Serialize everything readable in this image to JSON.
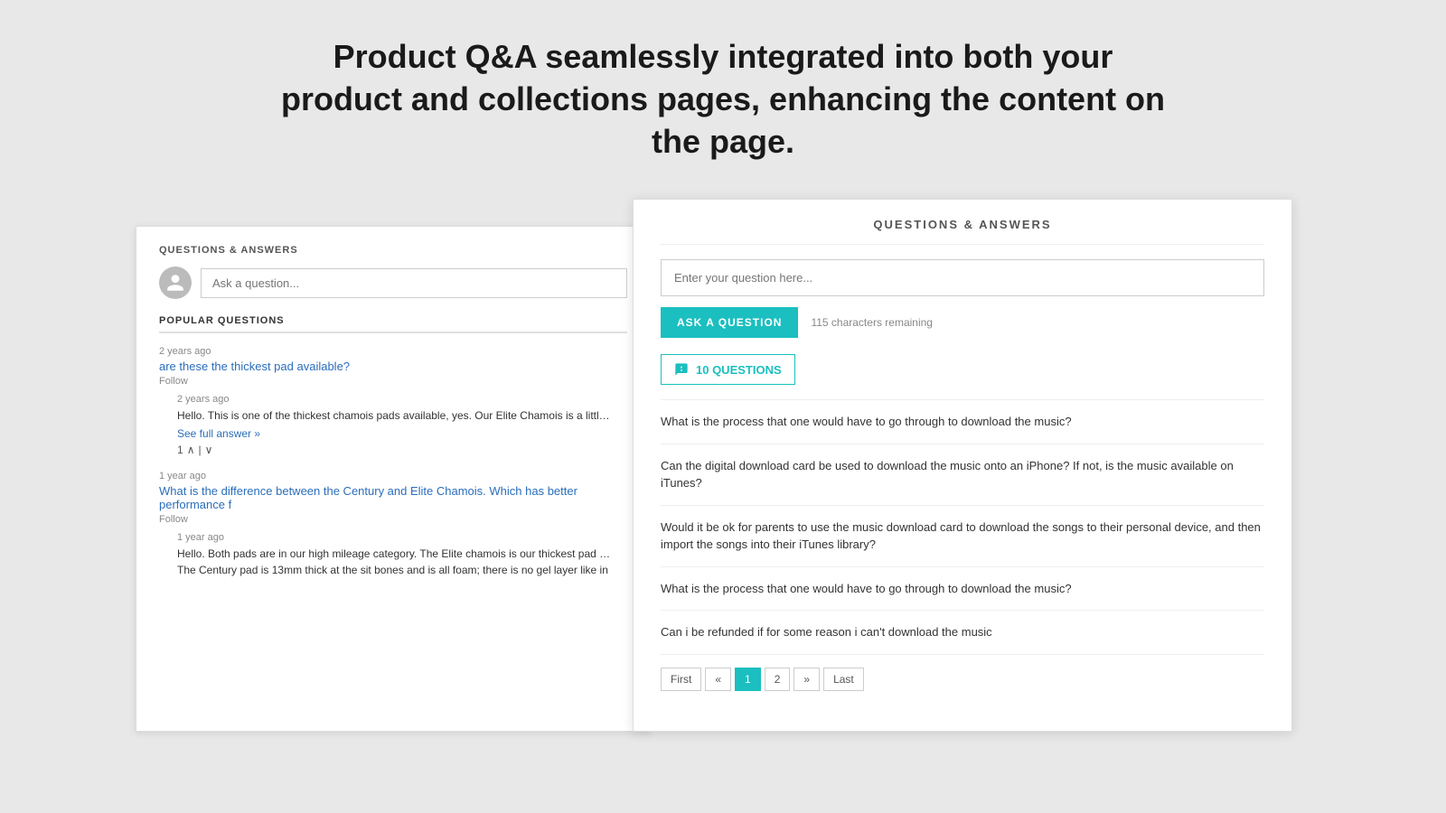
{
  "hero": {
    "title": "Product Q&A seamlessly integrated into both your  product and collections pages, enhancing the content on the page."
  },
  "left_card": {
    "section_title": "QUESTIONS & ANSWERS",
    "ask_placeholder": "Ask a question...",
    "popular_title": "POPULAR QUESTIONS",
    "questions": [
      {
        "meta": "2 years ago",
        "text": "are these the thickest pad available?",
        "follow": "Follow",
        "answer": {
          "meta": "2 years ago",
          "text": "Hello. This is one of the thickest chamois pads available, yes. Our Elite Chamois is a little b as well. Elite Shorts: https://www.aerotechdesigns.com/mens-elite-bike-shorts.html...",
          "see_full": "See full answer »",
          "votes": "1"
        }
      },
      {
        "meta": "1 year ago",
        "text": "What is the difference between the Century and Elite Chamois. Which has better performance f",
        "follow": "Follow",
        "answer": {
          "meta": "1 year ago",
          "text": "Hello. Both pads are in our high mileage category. The Elite chamois is our thickest pad in layer at the sit bones as well.",
          "see_full": "",
          "votes": ""
        }
      }
    ],
    "second_answer_text2": "The Century pad is 13mm thick at the sit bones and is all foam; there is no gel layer like in"
  },
  "right_card": {
    "section_title": "QUESTIONS & ANSWERS",
    "question_placeholder": "Enter your question here...",
    "ask_btn_label": "ASK A QUESTION",
    "chars_remaining": "115 characters remaining",
    "tab_label": "10 QUESTIONS",
    "questions": [
      {
        "text": "What is the process that one would have to go through to download the music?"
      },
      {
        "text": "Can the digital download card be used to download the music onto an iPhone? If not, is the music available on iTunes?"
      },
      {
        "text": "Would it be ok for parents to use the music download card to download the songs to their personal device, and then import the songs into their iTunes library?"
      },
      {
        "text": "What is the process that one would have to go through to download the music?"
      },
      {
        "text": "Can i be refunded if for some reason i can't download the music"
      }
    ],
    "pagination": {
      "first": "First",
      "prev_prev": "«",
      "page1": "1",
      "page2": "2",
      "next_next": "»",
      "last": "Last"
    }
  }
}
